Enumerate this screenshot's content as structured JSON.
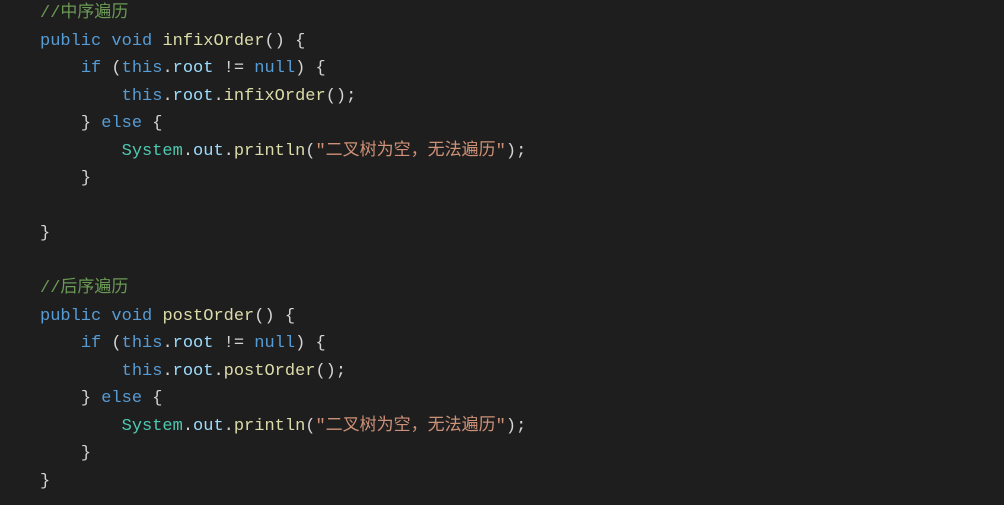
{
  "code": {
    "comment1": "//中序遍历",
    "method1": {
      "modifier": "public",
      "returnType": "void",
      "name": "infixOrder",
      "ifCond": {
        "thisKw": "this",
        "dot": ".",
        "prop": "root",
        "op": "!=",
        "nullKw": "null"
      },
      "ifBody": {
        "thisKw": "this",
        "prop": "root",
        "call": "infixOrder"
      },
      "elseKw": "else",
      "elseBody": {
        "sys": "System",
        "out": "out",
        "println": "println",
        "str": "\"二叉树为空，无法遍历\""
      }
    },
    "comment2": "//后序遍历",
    "method2": {
      "modifier": "public",
      "returnType": "void",
      "name": "postOrder",
      "ifCond": {
        "thisKw": "this",
        "dot": ".",
        "prop": "root",
        "op": "!=",
        "nullKw": "null"
      },
      "ifBody": {
        "thisKw": "this",
        "prop": "root",
        "call": "postOrder"
      },
      "elseKw": "else",
      "elseBody": {
        "sys": "System",
        "out": "out",
        "println": "println",
        "str": "\"二叉树为空，无法遍历\""
      }
    },
    "kw": {
      "if": "if",
      "else": "else"
    }
  }
}
